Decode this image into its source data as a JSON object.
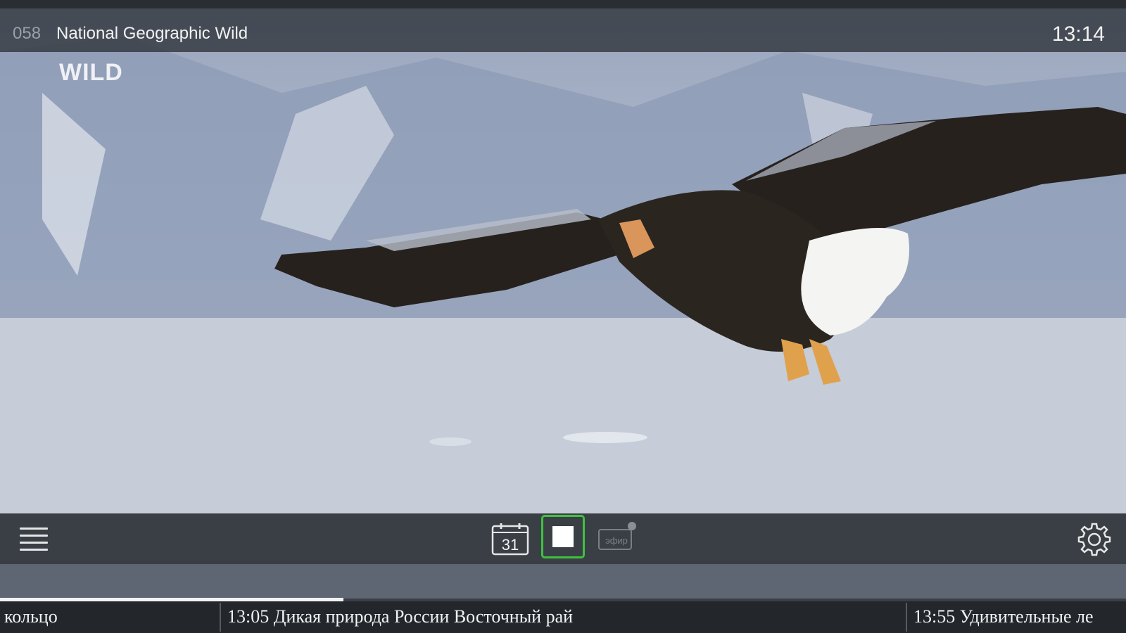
{
  "header": {
    "channel_number": "058",
    "channel_name": "National Geographic Wild",
    "clock": "13:14"
  },
  "video": {
    "channel_logo": "WILD"
  },
  "toolbar": {
    "menu_icon": "hamburger-menu-icon",
    "calendar_icon": "calendar-icon",
    "calendar_day": "31",
    "stop_icon": "stop-icon",
    "live_icon": "live-broadcast-icon",
    "live_label": "эфир",
    "settings_icon": "gear-icon",
    "stop_highlight_color": "#3ec23e"
  },
  "progress": {
    "fraction": 0.305
  },
  "epg": {
    "items": [
      {
        "text": "кольцо"
      },
      {
        "text": "13:05 Дикая природа России Восточный рай"
      },
      {
        "text": "13:55 Удивительные ле"
      }
    ]
  }
}
